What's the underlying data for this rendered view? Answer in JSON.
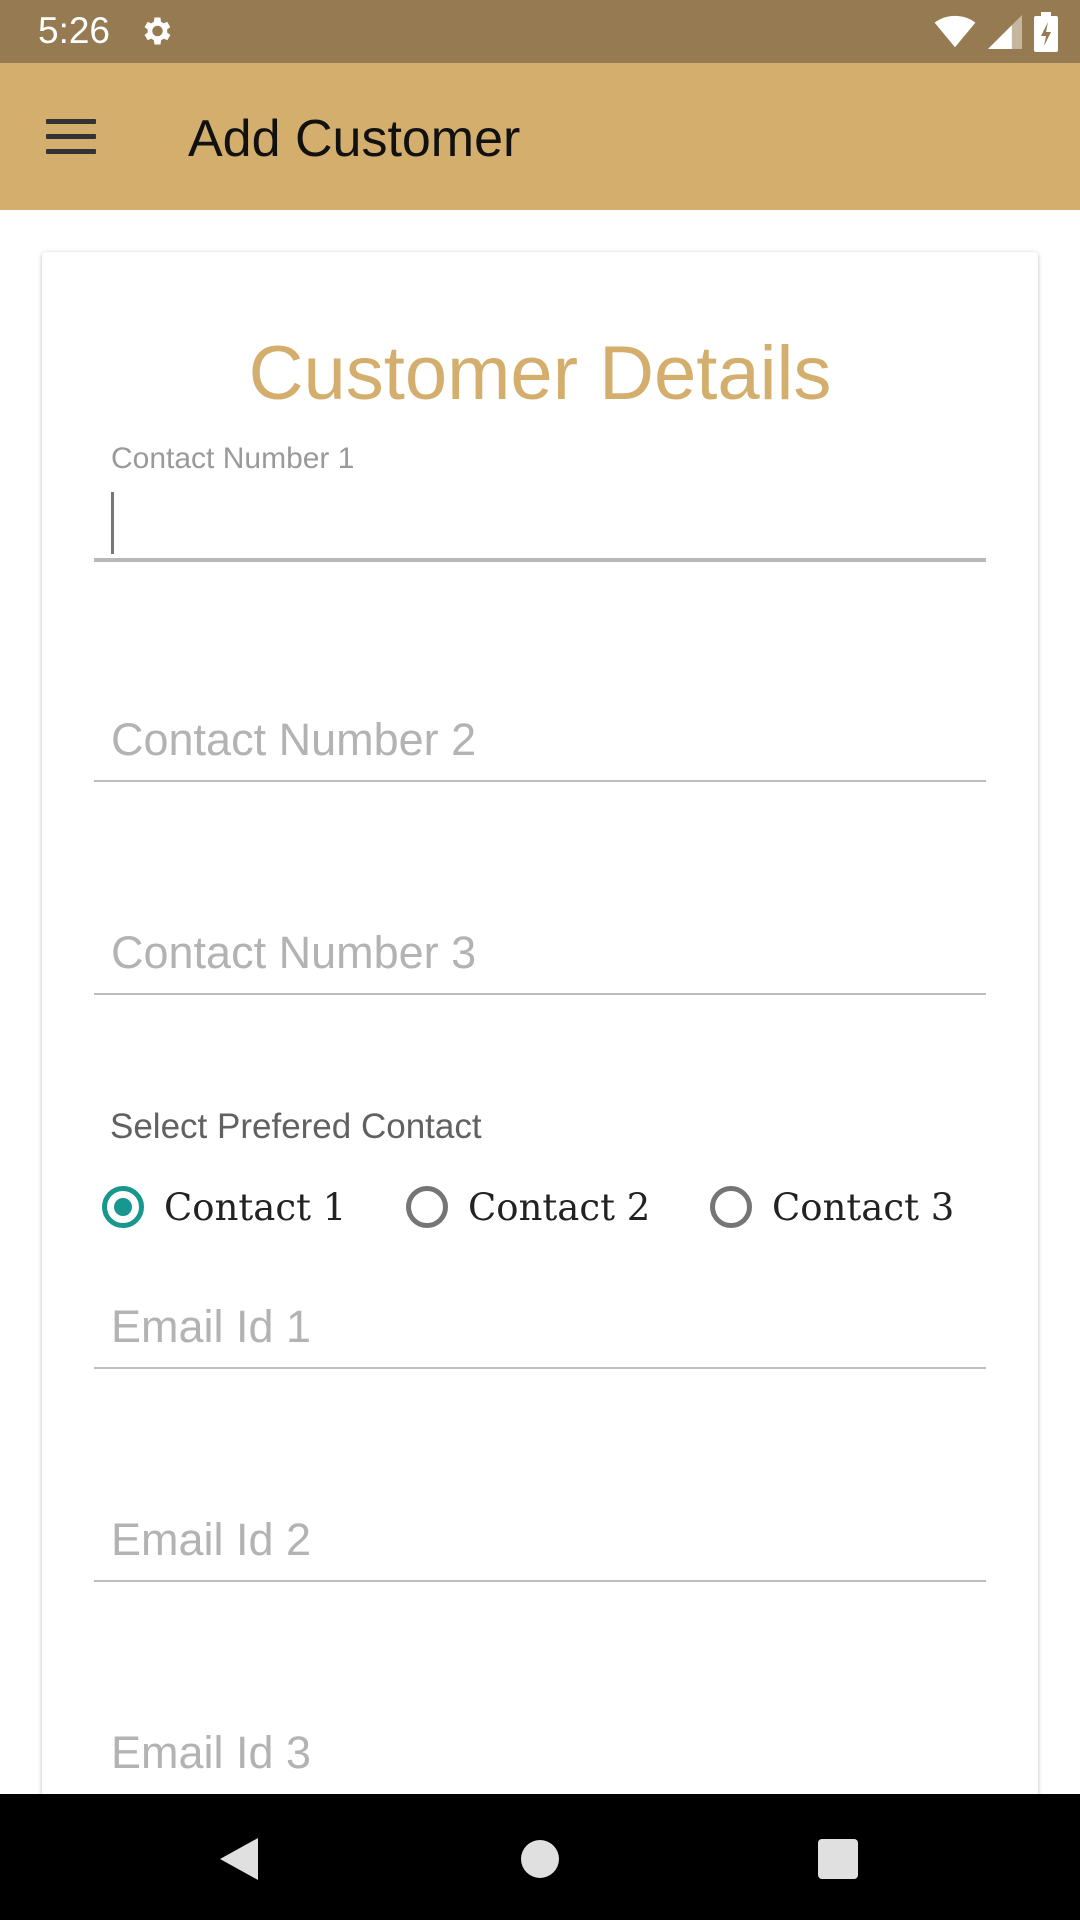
{
  "status_bar": {
    "time": "5:26",
    "icons": [
      "settings-gear-icon",
      "wifi-icon",
      "cell-signal-icon",
      "battery-charging-icon"
    ]
  },
  "app_bar": {
    "menu_icon": "hamburger-menu-icon",
    "title": "Add Customer"
  },
  "form": {
    "title": "Customer Details",
    "contact_number_1": {
      "label": "Contact Number 1",
      "value": ""
    },
    "contact_number_2": {
      "placeholder": "Contact Number 2",
      "value": ""
    },
    "contact_number_3": {
      "placeholder": "Contact Number 3",
      "value": ""
    },
    "preferred_contact": {
      "label": "Select Prefered Contact",
      "options": [
        "Contact 1",
        "Contact 2",
        "Contact 3"
      ],
      "selected": "Contact 1"
    },
    "email_1": {
      "placeholder": "Email Id 1",
      "value": ""
    },
    "email_2": {
      "placeholder": "Email Id 2",
      "value": ""
    },
    "email_3": {
      "placeholder": "Email Id 3",
      "value": ""
    }
  },
  "nav_bar": {
    "icons": [
      "back-icon",
      "home-icon",
      "recents-icon"
    ]
  },
  "colors": {
    "status_bar": "#967b52",
    "app_bar": "#d3ae6c",
    "accent_title": "#d3ae6c",
    "radio_checked": "#17978e"
  }
}
